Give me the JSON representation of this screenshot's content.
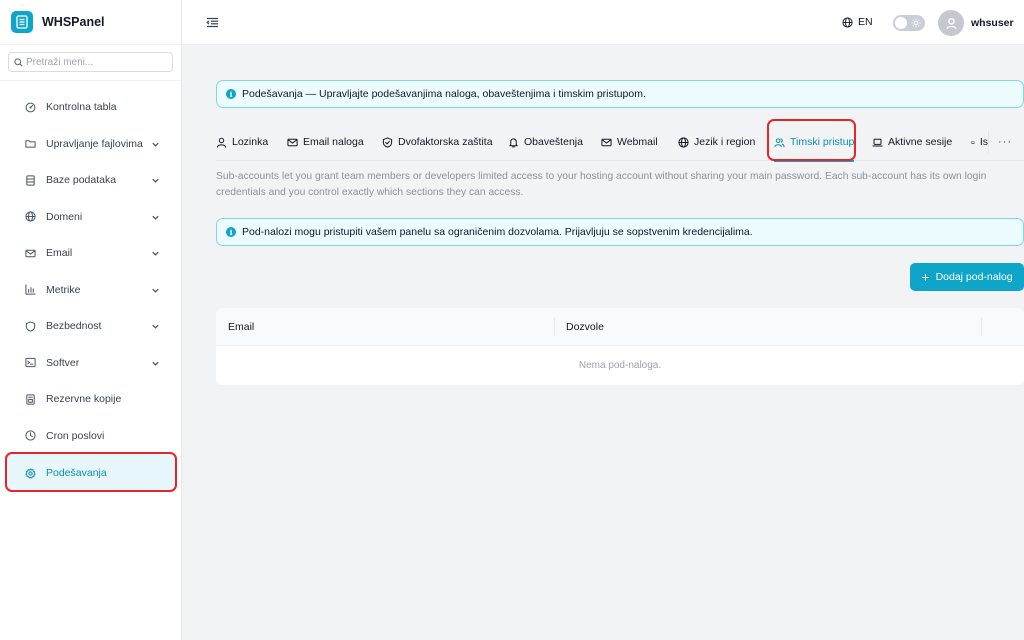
{
  "brand": {
    "name": "WHSPanel"
  },
  "search": {
    "placeholder": "Pretraži meni..."
  },
  "sidebar": {
    "items": [
      {
        "label": "Kontrolna tabla",
        "icon": "dashboard-icon",
        "chevron": false
      },
      {
        "label": "Upravljanje fajlovima",
        "icon": "folder-icon",
        "chevron": true
      },
      {
        "label": "Baze podataka",
        "icon": "database-icon",
        "chevron": true
      },
      {
        "label": "Domeni",
        "icon": "globe-icon",
        "chevron": true
      },
      {
        "label": "Email",
        "icon": "mail-icon",
        "chevron": true
      },
      {
        "label": "Metrike",
        "icon": "bar-chart-icon",
        "chevron": true
      },
      {
        "label": "Bezbednost",
        "icon": "shield-icon",
        "chevron": true
      },
      {
        "label": "Softver",
        "icon": "terminal-icon",
        "chevron": true
      },
      {
        "label": "Rezervne kopije",
        "icon": "backup-icon",
        "chevron": false
      },
      {
        "label": "Cron poslovi",
        "icon": "clock-icon",
        "chevron": false
      },
      {
        "label": "Podešavanja",
        "icon": "gear-icon",
        "chevron": false,
        "active": true
      }
    ]
  },
  "topbar": {
    "language": "EN",
    "username": "whsuser",
    "theme_toggle": "light"
  },
  "info_banner": {
    "text": "Podešavanja — Upravljajte podešavanjima naloga, obaveštenjima i timskim pristupom."
  },
  "tabs": [
    {
      "label": "Lozinka",
      "icon": "user-icon"
    },
    {
      "label": "Email naloga",
      "icon": "mail-icon"
    },
    {
      "label": "Dvofaktorska zaštita",
      "icon": "shield-check-icon"
    },
    {
      "label": "Obaveštenja",
      "icon": "bell-icon"
    },
    {
      "label": "Webmail",
      "icon": "mail-icon"
    },
    {
      "label": "Jezik i region",
      "icon": "globe-icon"
    },
    {
      "label": "Timski pristup",
      "icon": "users-icon",
      "active": true
    },
    {
      "label": "Aktivne sesije",
      "icon": "laptop-icon"
    },
    {
      "label": "Is",
      "icon": "laptop-icon"
    }
  ],
  "tabs_more": "···",
  "description": "Sub-accounts let you grant team members or developers limited access to your hosting account without sharing your main password. Each sub-account has its own login credentials and you control exactly which sections they can access.",
  "subaccount_info": {
    "text": "Pod-nalozi mogu pristupiti vašem panelu sa ograničenim dozvolama. Prijavljuju se sopstvenim kredencijalima."
  },
  "add_button": {
    "label": "Dodaj pod-nalog"
  },
  "table": {
    "columns": [
      "Email",
      "Dozvole"
    ],
    "empty_text": "Nema pod-naloga."
  },
  "colors": {
    "accent": "#0ea5c9",
    "highlight": "#e5252a",
    "info_bg": "#ecfbfd",
    "info_border": "#7dd8ea"
  }
}
